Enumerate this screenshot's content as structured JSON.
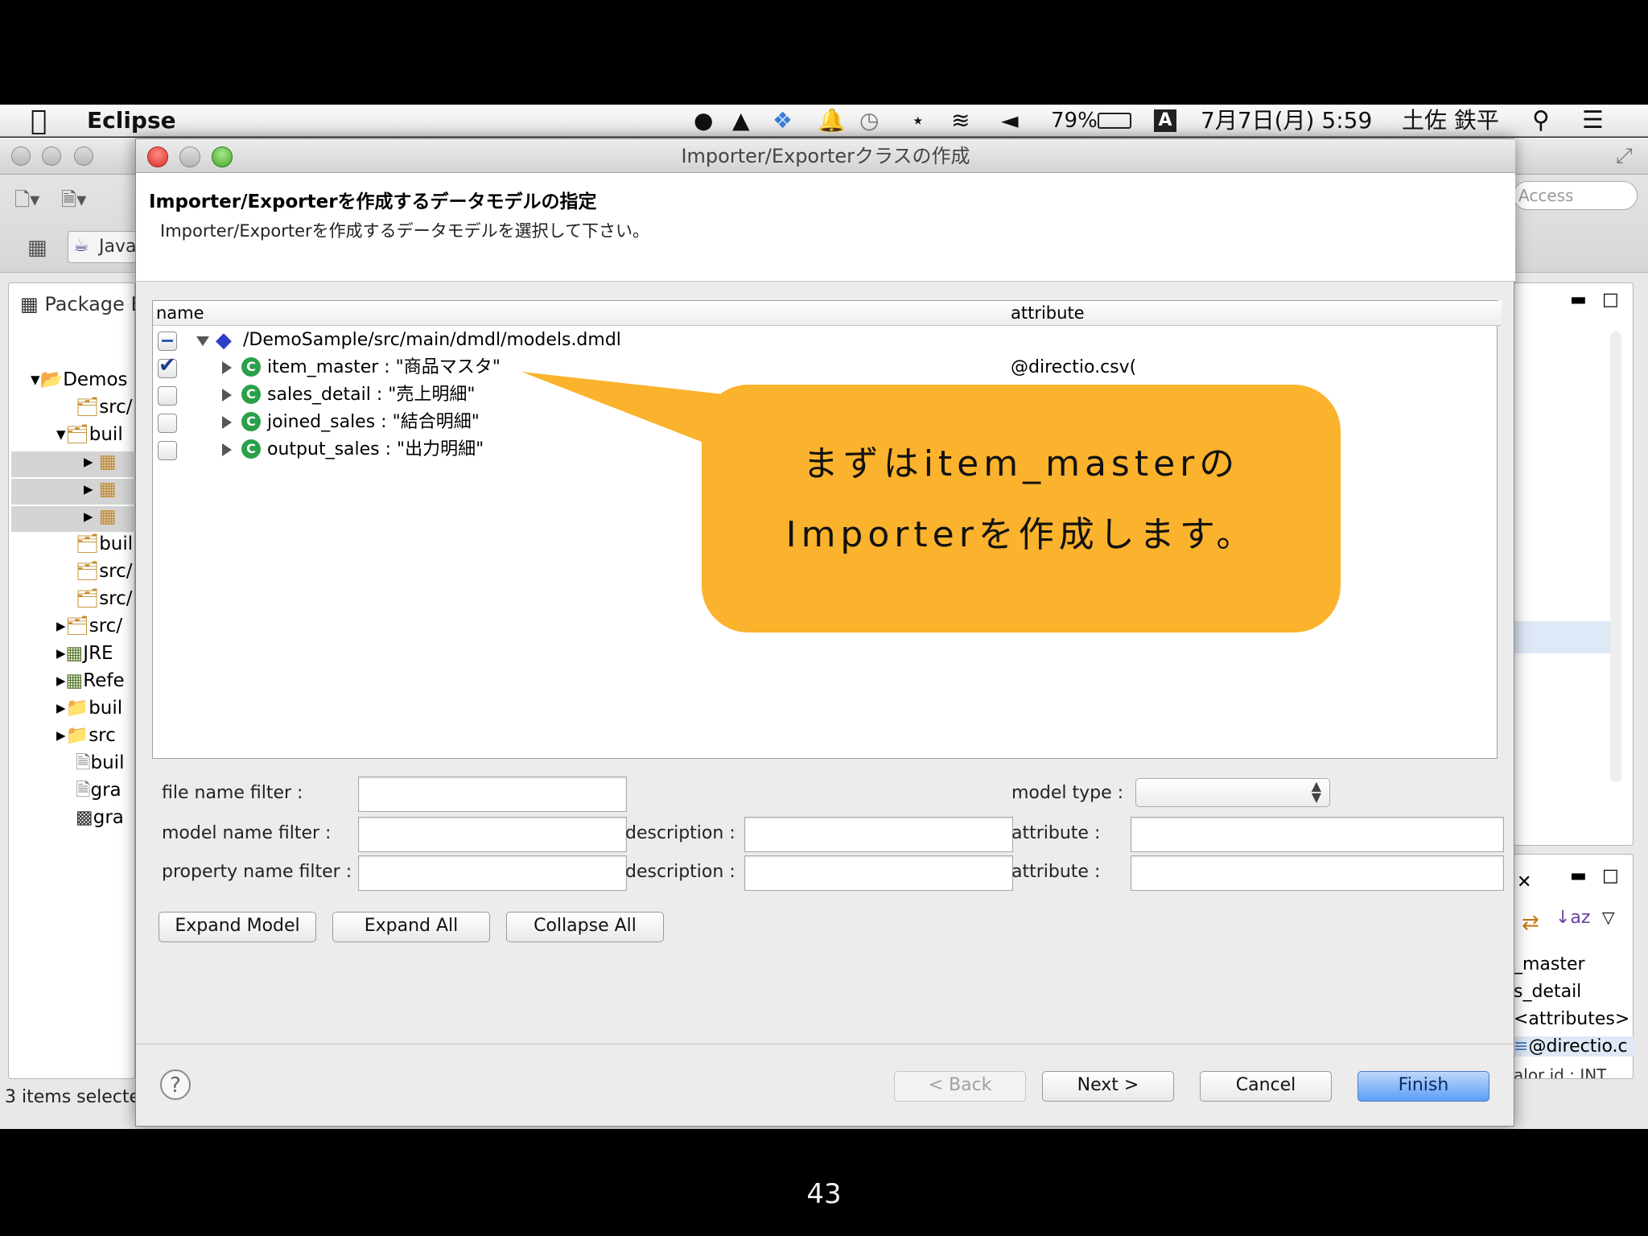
{
  "menubar": {
    "app_name": "Eclipse",
    "battery": "79%",
    "input_indicator": "A",
    "datetime": "7月7日(月) 5:59",
    "user": "土佐 鉄平"
  },
  "eclipse": {
    "quick_access": "Access",
    "perspective": "Java",
    "package_panel_title": "Package E",
    "package_tree": [
      "Demos",
      "src/",
      "buil",
      "",
      "",
      "",
      "buil",
      "src/",
      "src/",
      "src/",
      "JRE",
      "Refe",
      "buil",
      "src",
      "buil",
      "gra",
      "gra"
    ],
    "status": "3 items selecte",
    "outline_items": [
      "_master",
      "s_detail",
      "<attributes>",
      "@directio.c",
      "alor id : INT"
    ]
  },
  "dialog": {
    "title": "Importer/Exporterクラスの作成",
    "header_title": "Importer/Exporterを作成するデータモデルの指定",
    "header_desc": "Importer/Exporterを作成するデータモデルを選択して下さい。",
    "columns": {
      "name": "name",
      "attribute": "attribute"
    },
    "root": "/DemoSample/src/main/dmdl/models.dmdl",
    "models": [
      {
        "label": "item_master : \"商品マスタ\"",
        "attribute": "@directio.csv(",
        "checked": true
      },
      {
        "label": "sales_detail : \"売上明細\"",
        "attribute": "",
        "checked": false
      },
      {
        "label": "joined_sales : \"結合明細\"",
        "attribute": "",
        "checked": false
      },
      {
        "label": "output_sales : \"出力明細\"",
        "attribute": "",
        "checked": false
      }
    ],
    "filters": {
      "file_name_filter": "file name filter :",
      "model_type": "model type :",
      "model_name_filter": "model name filter :",
      "property_name_filter": "property name filter :",
      "description": "description :",
      "attribute": "attribute :"
    },
    "buttons": {
      "expand_model": "Expand Model",
      "expand_all": "Expand All",
      "collapse_all": "Collapse All",
      "back": "< Back",
      "next": "Next >",
      "cancel": "Cancel",
      "finish": "Finish"
    }
  },
  "callout": {
    "line1": "まずはitem_masterの",
    "line2": "Importerを作成します。"
  },
  "page_number": "43"
}
